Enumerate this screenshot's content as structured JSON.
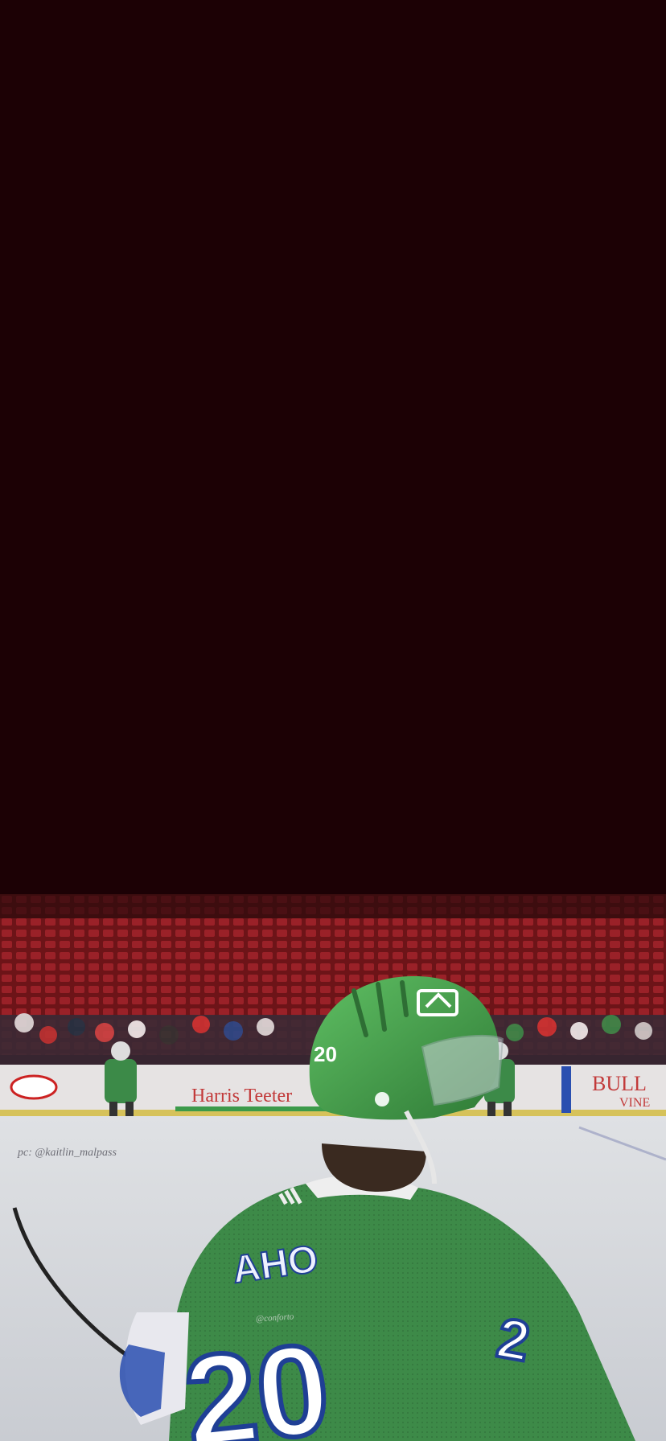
{
  "photo_text": {
    "photographer_credit": "pc: @kaitlin_malpass",
    "watermark": "@conforto",
    "nameplate": "AHO",
    "jersey_number": "20",
    "helmet_number": "20",
    "sleeve_number": "2",
    "board_ad_center": "Harris Teeter",
    "board_ad_right_top": "BULL",
    "board_ad_right_bottom": "VINE"
  },
  "colors": {
    "background": "#1c0105",
    "jersey_green": "#3f8a4a",
    "helmet_green": "#4aa34f",
    "number_blue": "#1f3f95",
    "seat_red": "#8c1c22",
    "ice": "#e7e8ea"
  }
}
